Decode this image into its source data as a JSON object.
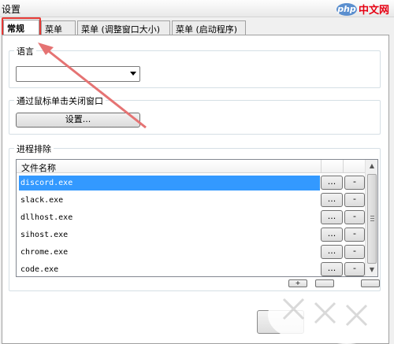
{
  "window": {
    "title": "设置"
  },
  "logo": {
    "badge": "php",
    "text": "中文网"
  },
  "tabs": [
    {
      "label": "常规",
      "active": true
    },
    {
      "label": "菜单"
    },
    {
      "label": "菜单 (调整窗口大小)"
    },
    {
      "label": "菜单 (启动程序)"
    }
  ],
  "language": {
    "label": "语言",
    "value": ""
  },
  "close_window": {
    "label": "通过鼠标单击关闭窗口",
    "button": "设置..."
  },
  "exclusion": {
    "label": "进程排除",
    "column": "文件名称",
    "rows": [
      {
        "name": "discord.exe",
        "selected": true
      },
      {
        "name": "slack.exe"
      },
      {
        "name": "dllhost.exe"
      },
      {
        "name": "sihost.exe"
      },
      {
        "name": "chrome.exe"
      },
      {
        "name": "code.exe"
      }
    ],
    "dots_label": "...",
    "minus_label": "-",
    "plus_label": "+"
  },
  "colors": {
    "accent": "#3399ff",
    "highlight": "#e53935"
  }
}
